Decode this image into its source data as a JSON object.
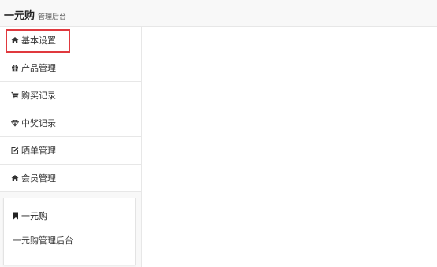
{
  "header": {
    "brand": "一元购",
    "subtitle": "管理后台"
  },
  "sidebar": {
    "items": [
      {
        "label": "基本设置",
        "icon": "home-icon"
      },
      {
        "label": "产品管理",
        "icon": "gift-icon"
      },
      {
        "label": "购买记录",
        "icon": "cart-icon"
      },
      {
        "label": "中奖记录",
        "icon": "diamond-icon"
      },
      {
        "label": "晒单管理",
        "icon": "edit-icon"
      },
      {
        "label": "会员管理",
        "icon": "home-icon"
      }
    ],
    "selected_index": 0,
    "highlight_color": "#e0393e"
  },
  "info_panel": {
    "title": "一元购",
    "title_icon": "bookmark-icon",
    "description": "一元购管理后台"
  }
}
